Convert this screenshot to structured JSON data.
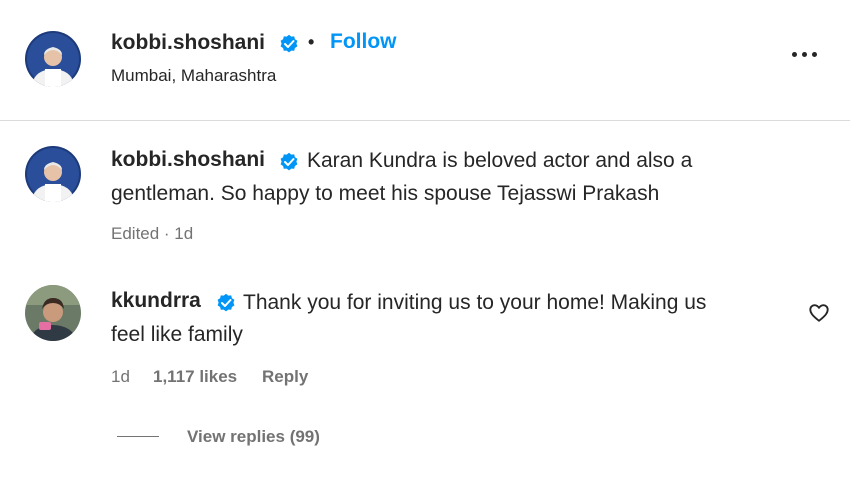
{
  "post_header": {
    "username": "kobbi.shoshani",
    "separator": "•",
    "follow_label": "Follow",
    "location": "Mumbai, Maharashtra",
    "more_icon": "more-horizontal-icon"
  },
  "caption": {
    "username": "kobbi.shoshani",
    "text_line1": "Karan Kundra is beloved actor and also a",
    "text_line2": "gentleman. So happy to meet his spouse Tejasswi Prakash",
    "meta": "Edited · 1d"
  },
  "comment": {
    "username": "kkundrra",
    "text_line1": "Thank you for inviting us to your home! Making us",
    "text_line2": "feel like family",
    "time": "1d",
    "likes": "1,117 likes",
    "reply_label": "Reply",
    "heart_icon": "heart-icon",
    "view_replies": "View replies (99)"
  },
  "colors": {
    "accent": "#0095f6",
    "verified": "#0095f6",
    "text": "#262626",
    "secondary": "#737373",
    "divider": "#dbdbdb"
  }
}
